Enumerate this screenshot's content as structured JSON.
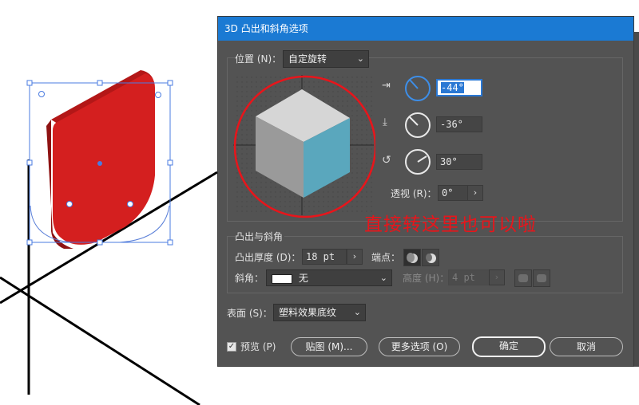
{
  "dialog": {
    "title": "3D 凸出和斜角选项",
    "position": {
      "label": "位置 (N)：",
      "preset": "自定旋转",
      "x_rotation": "-44°",
      "y_rotation": "-36°",
      "z_rotation": "30°",
      "perspective_label": "透视 (R)：",
      "perspective_value": "0°"
    },
    "extrude": {
      "section_title": "凸出与斜角",
      "depth_label": "凸出厚度 (D)：",
      "depth_value": "18 pt",
      "cap_label": "端点：",
      "bevel_label": "斜角：",
      "bevel_value": "无",
      "height_label": "高度 (H)：",
      "height_value": "4 pt"
    },
    "surface": {
      "label": "表面 (S)：",
      "value": "塑料效果底纹"
    },
    "footer": {
      "preview_label": "预览 (P)",
      "preview_checked": true,
      "map_button": "贴图 (M)...",
      "more_options_button": "更多选项 (O)",
      "ok_button": "确定",
      "cancel_button": "取消"
    }
  },
  "annotation": {
    "text": "直接转这里也可以啦",
    "color": "#e8151b"
  },
  "colors": {
    "dialog_bg": "#535353",
    "title_bar": "#1b7ad3",
    "shape_red": "#d41f1f",
    "cube_top": "#d6d6d6",
    "cube_left": "#9a9a9a",
    "cube_right": "#5aa7bd",
    "selection": "#4a7be0"
  }
}
